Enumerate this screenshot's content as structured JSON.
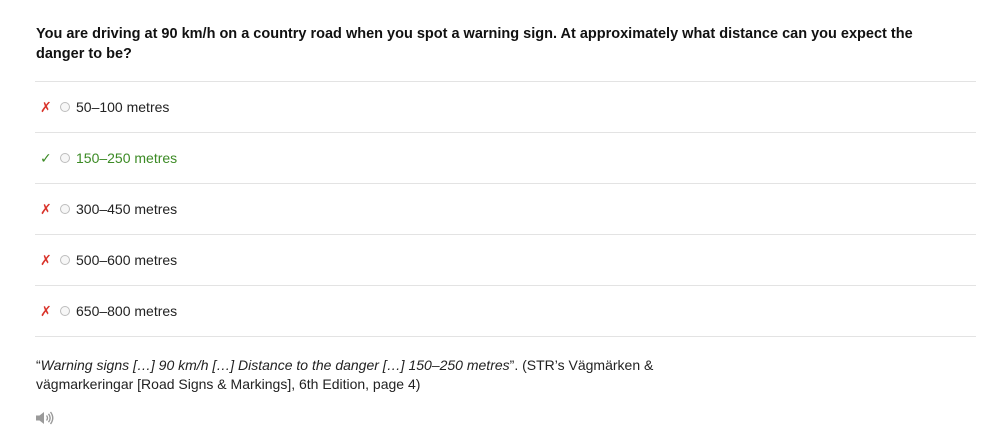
{
  "question": {
    "text": "You are driving at 90 km/h on a country road when you spot a warning sign. At approximately what distance can you expect the danger to be?"
  },
  "options": [
    {
      "mark": "✗",
      "status": "incorrect",
      "label": "50–100 metres"
    },
    {
      "mark": "✓",
      "status": "correct",
      "label": "150–250 metres"
    },
    {
      "mark": "✗",
      "status": "incorrect",
      "label": "300–450 metres"
    },
    {
      "mark": "✗",
      "status": "incorrect",
      "label": "500–600 metres"
    },
    {
      "mark": "✗",
      "status": "incorrect",
      "label": "650–800 metres"
    }
  ],
  "explanation": {
    "quote_open": "“",
    "quote_text": "Warning signs […] 90 km/h […] Distance to the danger […] 150–250 metres",
    "quote_close": "”",
    "source": ". (STR’s Vägmärken & vägmarkeringar [Road Signs & Markings], 6th Edition, page 4)"
  },
  "audio": {
    "icon": "speaker-icon"
  },
  "colors": {
    "correct": "#3b8a24",
    "incorrect": "#d9342b",
    "divider": "#e3e3e3"
  }
}
